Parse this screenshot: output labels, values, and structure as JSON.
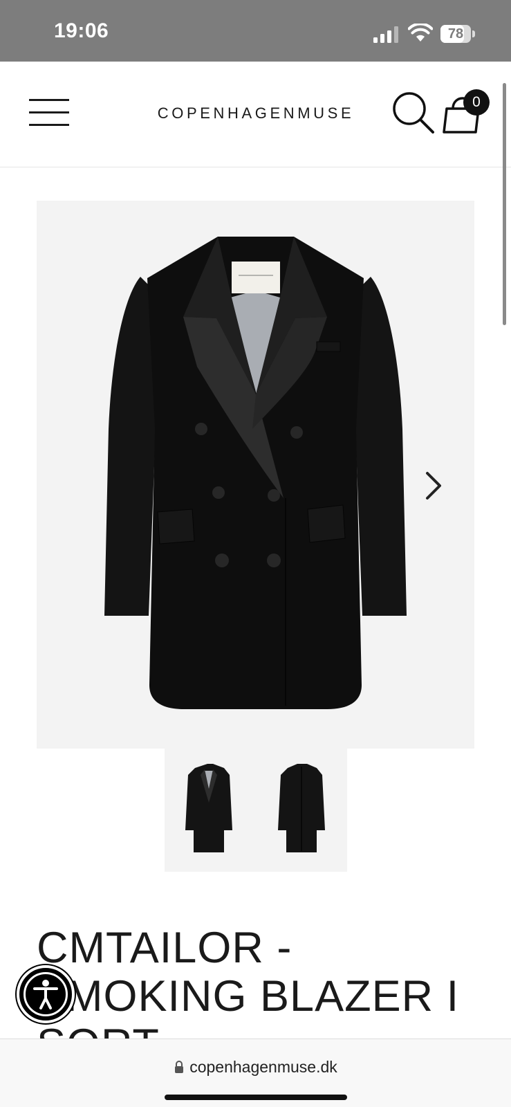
{
  "status_bar": {
    "time": "19:06",
    "battery_level": "78",
    "battery_fraction": 0.78,
    "icons": [
      "signal-icon",
      "wifi-icon",
      "battery-icon"
    ]
  },
  "header": {
    "logo_text": "COPENHAGENMUSE",
    "menu_icon": "hamburger-menu-icon",
    "search_icon": "search-icon",
    "cart_icon": "shopping-bag-icon",
    "cart_count": "0"
  },
  "gallery": {
    "main_image": "black double-breasted smoking blazer, front view",
    "next_icon": "chevron-right-icon",
    "thumbnails": [
      {
        "name": "blazer front view"
      },
      {
        "name": "blazer back view"
      }
    ],
    "background_color": "#f3f3f3"
  },
  "product": {
    "title": "CMTAILOR - SMOKING BLAZER I SORT"
  },
  "accessibility": {
    "icon": "accessibility-icon"
  },
  "browser": {
    "url": "copenhagenmuse.dk",
    "lock_icon": "lock-icon"
  },
  "colors": {
    "status_bar_bg": "#7d7d7d",
    "text": "#1a1a1a",
    "image_bg": "#f3f3f3"
  }
}
